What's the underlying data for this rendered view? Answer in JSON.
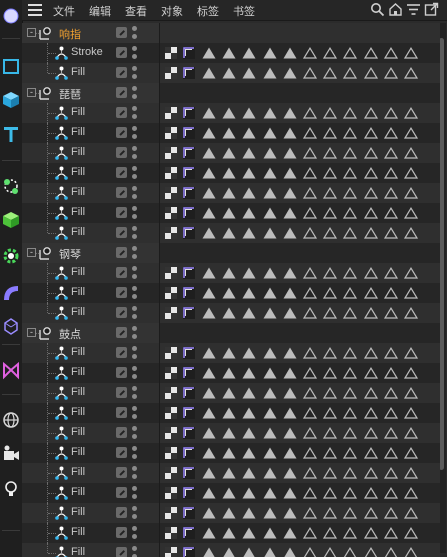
{
  "menu": {
    "items": [
      "文件",
      "编辑",
      "查看",
      "对象",
      "标签",
      "书签"
    ]
  },
  "toolbar": {
    "tools": [
      "sphere-icon",
      "cube-outline-icon",
      "cube-icon",
      "text-tool-icon",
      "spline-node-icon",
      "extrude-icon",
      "gear-generator-icon",
      "bend-deformer-icon",
      "polygon-icon",
      "field-icon",
      "globe-icon",
      "camera-icon",
      "light-icon"
    ]
  },
  "header_icons": [
    "search-icon",
    "home-icon",
    "filter-icon",
    "new-window-icon"
  ],
  "colors": {
    "active_text": "#f0a030",
    "active_sub_text": "#e08a2a",
    "normal_text": "#c8c8c8",
    "tag_fill": "#bdbdbd"
  },
  "tree": {
    "rows": [
      {
        "type": "group",
        "label": "响指",
        "expander": "-",
        "active": true
      },
      {
        "type": "child",
        "label": "Stroke",
        "active": true
      },
      {
        "type": "child",
        "label": "Fill",
        "active": true
      },
      {
        "type": "group",
        "label": "琵琶",
        "expander": "-"
      },
      {
        "type": "child",
        "label": "Fill"
      },
      {
        "type": "child",
        "label": "Fill"
      },
      {
        "type": "child",
        "label": "Fill"
      },
      {
        "type": "child",
        "label": "Fill"
      },
      {
        "type": "child",
        "label": "Fill"
      },
      {
        "type": "child",
        "label": "Fill"
      },
      {
        "type": "child",
        "label": "Fill"
      },
      {
        "type": "group",
        "label": "钢琴",
        "expander": "-"
      },
      {
        "type": "child",
        "label": "Fill"
      },
      {
        "type": "child",
        "label": "Fill"
      },
      {
        "type": "child",
        "label": "Fill"
      },
      {
        "type": "group",
        "label": "鼓点",
        "expander": "-"
      },
      {
        "type": "child",
        "label": "Fill"
      },
      {
        "type": "child",
        "label": "Fill"
      },
      {
        "type": "child",
        "label": "Fill"
      },
      {
        "type": "child",
        "label": "Fill"
      },
      {
        "type": "child",
        "label": "Fill"
      },
      {
        "type": "child",
        "label": "Fill"
      },
      {
        "type": "child",
        "label": "Fill"
      },
      {
        "type": "child",
        "label": "Fill"
      },
      {
        "type": "child",
        "label": "Fill"
      },
      {
        "type": "child",
        "label": "Fill"
      },
      {
        "type": "child",
        "label": "Fill"
      }
    ],
    "tag_pattern": [
      "filled",
      "filled",
      "filled",
      "filled",
      "filled",
      "outline",
      "outline",
      "outline",
      "outline",
      "outline",
      "outline"
    ]
  }
}
